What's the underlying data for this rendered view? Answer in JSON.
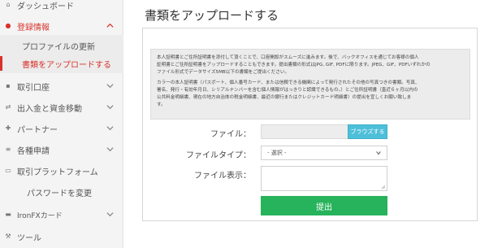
{
  "sidebar": {
    "items": [
      {
        "label": "ダッシュボード",
        "icon": "home-icon"
      },
      {
        "label": "登録情報",
        "icon": "user-icon",
        "active": true,
        "expanded": true
      },
      {
        "label": "取引口座",
        "icon": "briefcase-icon"
      },
      {
        "label": "出入金と資金移動",
        "icon": "transfer-icon"
      },
      {
        "label": "パートナー",
        "icon": "partner-icon"
      },
      {
        "label": "各種申請",
        "icon": "list-icon"
      },
      {
        "label": "取引プラットフォーム",
        "icon": "monitor-icon"
      },
      {
        "label": "パスワードを変更",
        "icon": ""
      },
      {
        "label": "IronFXカード",
        "icon": "card-icon"
      },
      {
        "label": "ツール",
        "icon": "tools-icon"
      }
    ],
    "subitems": [
      {
        "label": "プロファイルの更新"
      },
      {
        "label": "書類をアップロードする",
        "current": true
      }
    ]
  },
  "main": {
    "title": "書類をアップロードする",
    "notice": {
      "para1": "本人証明書とご住所証明書を添付して頂くことで、口座開設がスムーズに進みます。後で、バックオフィスを通じてお客様の個人\n証明書とご住所証明書をアップロードすることもできます。提出書類の形式はJPG, GIF, PDFに限ります。JPEG、GIF、PDFいずれかの\nファイル形式でデータサイズ5MB以下の書類をご提出ください。",
      "para2": "カラーの本人証明書（パスポート、個人番号カード、または信頼できる機関によって発行されたその他の写真つきの書類。写真、\n署名、発行・有効年月日、シリアルナンバーを含む個人情報がはっきりと認識できるもの。）とご住所証明書（直近６ヶ月以内の\n公共料金明細書、現在の地方自治体の税金明細書、最近の銀行またはクレジットカード明細書）の提出を宜しくお願い致しま\nす。"
    },
    "form": {
      "file_label": "ファイル：",
      "browse_label": "ブラウズする",
      "file_type_label": "ファイルタイプ：",
      "file_type_selected": "- 選択 -",
      "file_display_label": "ファイル表示：",
      "file_display_value": "",
      "submit_label": "提出"
    }
  },
  "colors": {
    "accent": "#d9322b",
    "browse": "#4dbfd9",
    "submit": "#27b35b",
    "sidebar_bg": "#f4f4f4"
  }
}
